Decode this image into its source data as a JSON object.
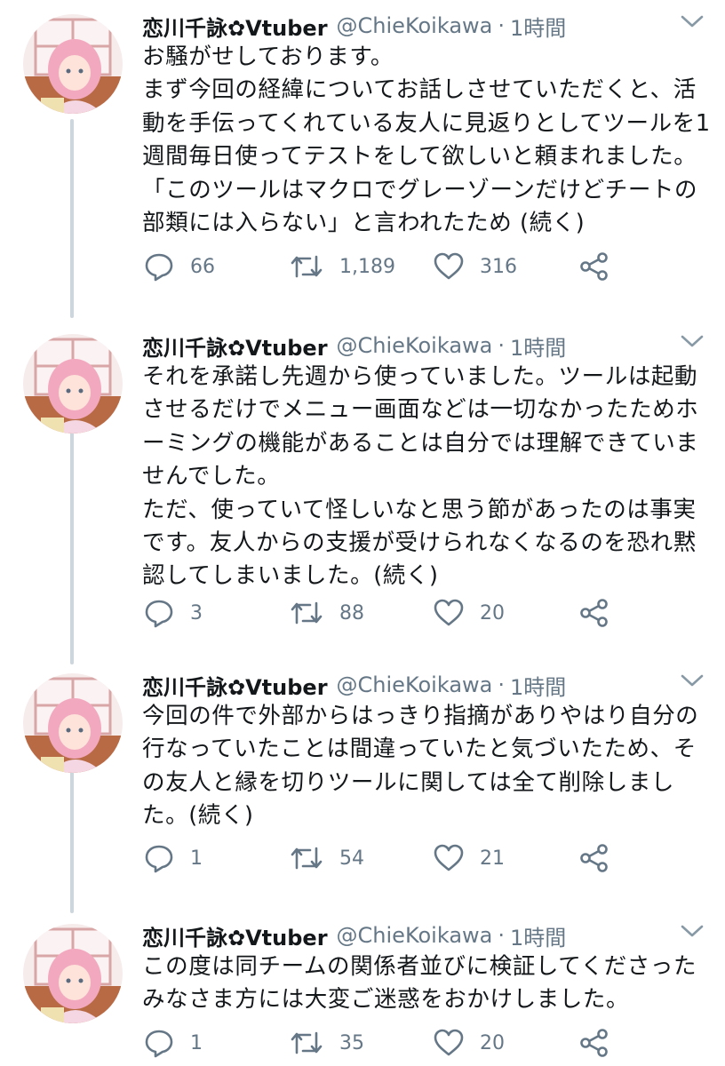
{
  "tweets": [
    {
      "display_name": "恋川千詠✿Vtuber",
      "handle": "@ChieKoikawa",
      "separator": "·",
      "time": "1時間",
      "text": "お騒がせしております。\nまず今回の経緯についてお話しさせていただくと、活動を手伝ってくれている友人に見返りとしてツールを1週間毎日使ってテストをして欲しいと頼まれました。「このツールはマクロでグレーゾーンだけどチートの部類には入らない」と言われたため (続く)",
      "replies": "66",
      "retweets": "1,189",
      "likes": "316"
    },
    {
      "display_name": "恋川千詠✿Vtuber",
      "handle": "@ChieKoikawa",
      "separator": "·",
      "time": "1時間",
      "text": "それを承諾し先週から使っていました。ツールは起動させるだけでメニュー画面などは一切なかったためホーミングの機能があることは自分では理解できていませんでした。\nただ、使っていて怪しいなと思う節があったのは事実です。友人からの支援が受けられなくなるのを恐れ黙認してしまいました。(続く)",
      "replies": "3",
      "retweets": "88",
      "likes": "20"
    },
    {
      "display_name": "恋川千詠✿Vtuber",
      "handle": "@ChieKoikawa",
      "separator": "·",
      "time": "1時間",
      "text": "今回の件で外部からはっきり指摘がありやはり自分の行なっていたことは間違っていたと気づいたため、その友人と縁を切りツールに関しては全て削除しました。(続く)",
      "replies": "1",
      "retweets": "54",
      "likes": "21"
    },
    {
      "display_name": "恋川千詠✿Vtuber",
      "handle": "@ChieKoikawa",
      "separator": "·",
      "time": "1時間",
      "text": "この度は同チームの関係者並びに検証してくださったみなさま方には大変ご迷惑をおかけしました。",
      "replies": "1",
      "retweets": "35",
      "likes": "20"
    }
  ],
  "icons": {
    "reply": "reply-icon",
    "retweet": "retweet-icon",
    "like": "heart-icon",
    "share": "share-icon",
    "menu": "chevron-down-icon"
  },
  "colors": {
    "text": "#14171a",
    "secondary": "#657786",
    "thread_line": "#ccd6dd"
  }
}
